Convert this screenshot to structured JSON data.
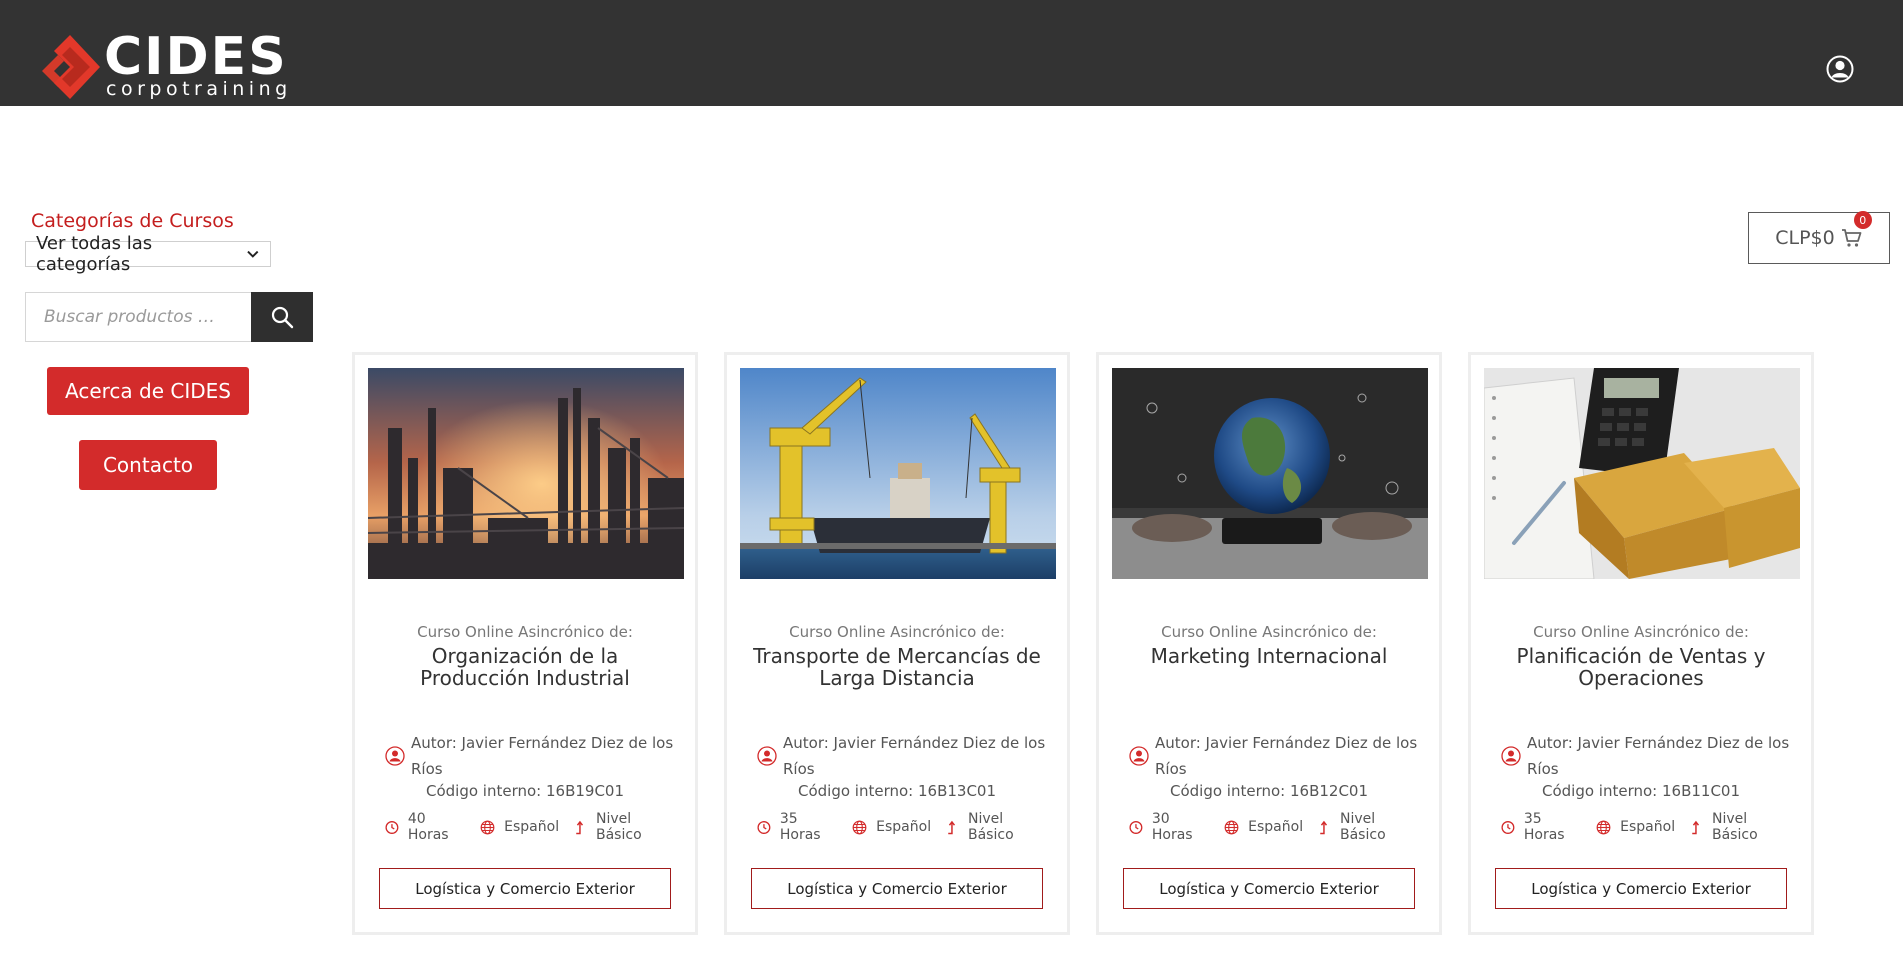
{
  "header": {
    "logo_main": "CIDES",
    "logo_sub": "corpotraining",
    "user_icon": "user-account-icon"
  },
  "sidebar": {
    "categories_title": "Categorías de Cursos",
    "categories_select_value": "Ver todas las categorías",
    "search_placeholder": "Buscar productos …",
    "about_button": "Acerca de CIDES",
    "contact_button": "Contacto"
  },
  "cart": {
    "amount": "CLP$0",
    "count": "0"
  },
  "colors": {
    "header_bg": "#333333",
    "accent_red": "#d32b2b",
    "title_red": "#c41e1e"
  },
  "products": [
    {
      "kicker": "Curso Online Asincrónico de:",
      "title": "Organización de la Producción Industrial",
      "author": "Autor: Javier Fernández Diez de los Ríos",
      "code": "Código interno: 16B19C01",
      "hours": "40 Horas",
      "language": "Español",
      "level": "Nivel Básico",
      "category": "Logística y Comercio Exterior",
      "image": "industrial-refinery-sunset"
    },
    {
      "kicker": "Curso Online Asincrónico de:",
      "title": "Transporte de Mercancías de Larga Distancia",
      "author": "Autor: Javier Fernández Diez de los Ríos",
      "code": "Código interno: 16B13C01",
      "hours": "35 Horas",
      "language": "Español",
      "level": "Nivel Básico",
      "category": "Logística y Comercio Exterior",
      "image": "harbor-cranes-ship"
    },
    {
      "kicker": "Curso Online Asincrónico de:",
      "title": "Marketing Internacional",
      "author": "Autor: Javier Fernández Diez de los Ríos",
      "code": "Código interno: 16B12C01",
      "hours": "30 Horas",
      "language": "Español",
      "level": "Nivel Básico",
      "category": "Logística y Comercio Exterior",
      "image": "globe-over-tablet"
    },
    {
      "kicker": "Curso Online Asincrónico de:",
      "title": "Planificación de Ventas y Operaciones",
      "author": "Autor: Javier Fernández Diez de los Ríos",
      "code": "Código interno: 16B11C01",
      "hours": "35 Horas",
      "language": "Español",
      "level": "Nivel Básico",
      "category": "Logística y Comercio Exterior",
      "image": "calculator-boxes-notebook"
    }
  ]
}
